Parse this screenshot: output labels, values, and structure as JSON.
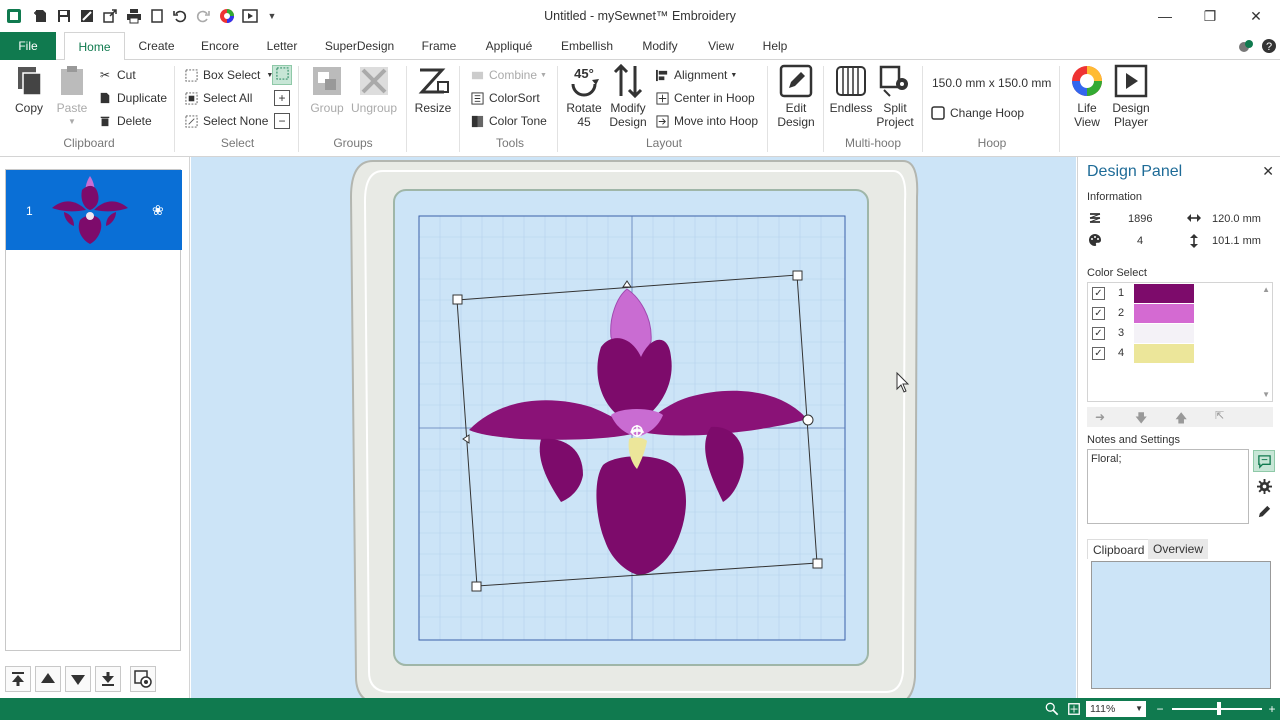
{
  "window": {
    "title": "Untitled  -  mySewnet™ Embroidery",
    "minimize": "—",
    "restore": "❐",
    "close": "✕"
  },
  "tabs": {
    "file": "File",
    "items": [
      "Home",
      "Create",
      "Encore",
      "Letter",
      "SuperDesign",
      "Frame",
      "Appliqué",
      "Embellish",
      "Modify",
      "View",
      "Help"
    ],
    "active": "Home"
  },
  "ribbon": {
    "clipboard": {
      "label": "Clipboard",
      "copy": "Copy",
      "paste": "Paste",
      "cut": "Cut",
      "duplicate": "Duplicate",
      "delete": "Delete"
    },
    "select": {
      "label": "Select",
      "box_select": "Box Select",
      "select_all": "Select All",
      "select_none": "Select None"
    },
    "groups": {
      "label": "Groups",
      "group": "Group",
      "ungroup": "Ungroup"
    },
    "resize": "Resize",
    "tools": {
      "label": "Tools",
      "combine": "Combine",
      "colorsort": "ColorSort",
      "color_tone": "Color Tone"
    },
    "layout": {
      "label": "Layout",
      "rotate_45": "Rotate\n45",
      "rotate_45_a": "Rotate",
      "rotate_45_b": "45",
      "modify_design_a": "Modify",
      "modify_design_b": "Design",
      "alignment": "Alignment",
      "center_in_hoop": "Center in Hoop",
      "move_into_hoop": "Move into Hoop"
    },
    "edit_design_a": "Edit",
    "edit_design_b": "Design",
    "multihoop": {
      "label": "Multi-hoop",
      "endless": "Endless",
      "split_project_a": "Split",
      "split_project_b": "Project"
    },
    "hoop": {
      "label": "Hoop",
      "size": "150.0 mm x 150.0 mm",
      "change_hoop": "Change Hoop"
    },
    "life_view_a": "Life",
    "life_view_b": "View",
    "design_player_a": "Design",
    "design_player_b": "Player"
  },
  "left_panel": {
    "design_number": "1"
  },
  "design_panel": {
    "title": "Design Panel",
    "close": "✕",
    "information_label": "Information",
    "stitches": "1896",
    "width": "120.0 mm",
    "colors": "4",
    "height": "101.1 mm",
    "color_select_label": "Color Select",
    "color_list": [
      {
        "num": "1",
        "color": "#7d0b6b",
        "checked": true
      },
      {
        "num": "2",
        "color": "#d46ad2",
        "checked": true
      },
      {
        "num": "3",
        "color": "#f4f2f7",
        "checked": true
      },
      {
        "num": "4",
        "color": "#ece69a",
        "checked": true
      }
    ],
    "notes_label": "Notes and Settings",
    "notes_value": "Floral;",
    "tab_clipboard": "Clipboard",
    "tab_overview": "Overview"
  },
  "status": {
    "zoom": "111%"
  },
  "colors": {
    "accent_green": "#107a4f",
    "selection_blue": "#0a6fd6",
    "canvas_blue": "#cce4f7",
    "panel_title_blue": "#1e6b97"
  }
}
